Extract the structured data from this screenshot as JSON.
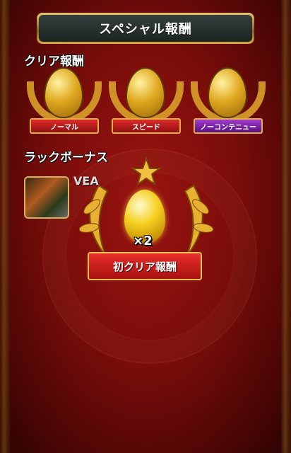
{
  "header": {
    "title": "スペシャル報酬"
  },
  "clear_rewards": {
    "label": "クリア報酬",
    "items": [
      {
        "label": "ノーマル",
        "color": "red"
      },
      {
        "label": "スピード",
        "color": "red"
      },
      {
        "label": "ノーコンテニュー",
        "color": "purple"
      }
    ]
  },
  "luck_bonus": {
    "label": "ラックボーナス",
    "monster_name": "VEA"
  },
  "first_clear": {
    "multiplier": "×2",
    "banner": "初クリア報酬"
  },
  "colors": {
    "gold": "#d9a02a",
    "red_banner": "#c81e1e",
    "background": "#7a0d0a"
  }
}
